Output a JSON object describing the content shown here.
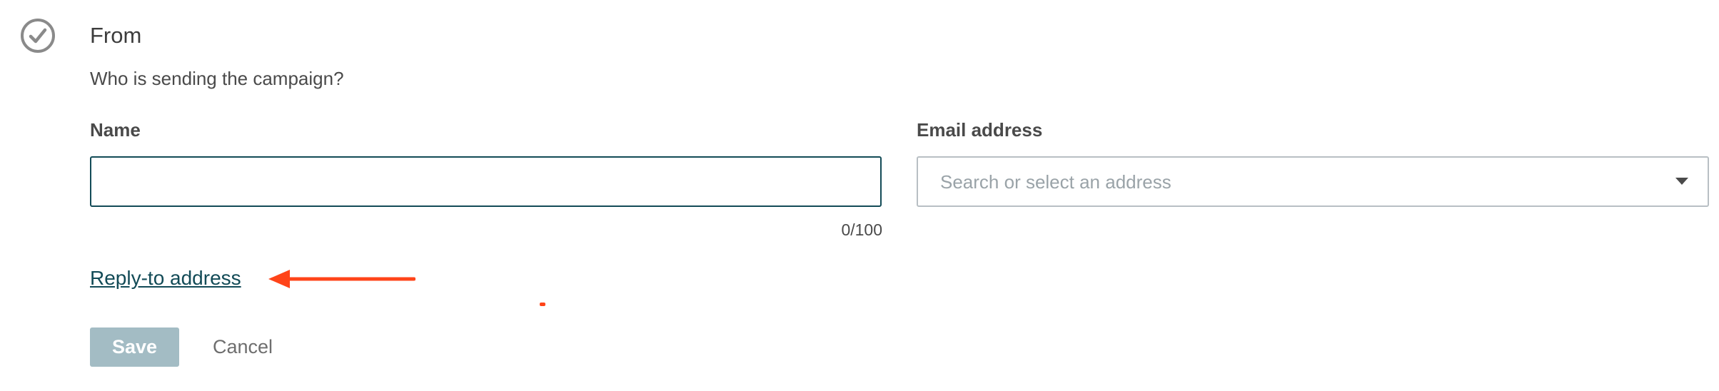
{
  "section": {
    "title": "From",
    "description": "Who is sending the campaign?",
    "status_icon": "check-circle-icon"
  },
  "name_field": {
    "label": "Name",
    "value": "",
    "placeholder": "",
    "counter": "0/100"
  },
  "email_field": {
    "label": "Email address",
    "placeholder": "Search or select an address",
    "dropdown_icon": "chevron-down-icon"
  },
  "reply_to": {
    "label": "Reply-to address"
  },
  "actions": {
    "save_label": "Save",
    "cancel_label": "Cancel"
  },
  "colors": {
    "accent": "#134b57",
    "annotation": "#ff4419",
    "save_disabled_bg": "#a3bcc4"
  }
}
